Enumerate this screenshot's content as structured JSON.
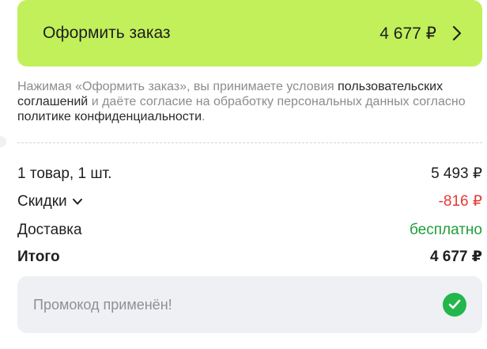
{
  "checkout": {
    "label": "Оформить заказ",
    "total": "4 677 ₽",
    "accent": "#c1f05a"
  },
  "agreement": {
    "part1": "Нажимая «Оформить заказ», вы принимаете условия ",
    "link1": "пользовательских соглашений",
    "part2": " и даёте согласие на обработку персональных данных согласно ",
    "link2": "политике конфиденциальности",
    "part3": "."
  },
  "summary": {
    "items_label": "1 товар, 1 шт.",
    "items_value": "5 493 ₽",
    "discount_label": "Скидки",
    "discount_value": "-816 ₽",
    "delivery_label": "Доставка",
    "delivery_value": "бесплатно",
    "total_label": "Итого",
    "total_value": "4 677 ₽"
  },
  "promo": {
    "text": "Промокод применён!",
    "status_color": "#23b64c"
  },
  "icons": {
    "checkout_arrow": "chevron-right-icon",
    "discount_toggle": "chevron-down-icon",
    "promo_status": "check-circle-icon"
  }
}
